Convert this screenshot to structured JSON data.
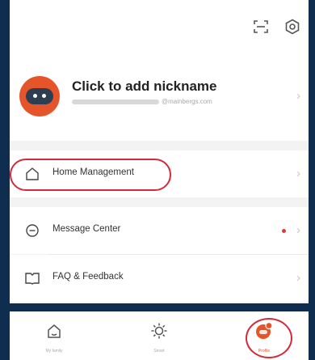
{
  "profile": {
    "nickname": "Click to add nickname",
    "account_suffix": "@mainbergs.com"
  },
  "menu": {
    "home_management": "Home Management",
    "message_center": "Message Center",
    "faq_feedback": "FAQ & Feedback",
    "message_unread": true
  },
  "tabs": [
    {
      "label": "My family",
      "icon": "home-icon"
    },
    {
      "label": "Smart",
      "icon": "sun-icon"
    },
    {
      "label": "Profile",
      "icon": "profile-icon",
      "active": true
    }
  ],
  "colors": {
    "accent": "#e6552a",
    "annotation": "#d22b3b",
    "frame": "#0f2d4f",
    "unread_dot": "#e03a2f"
  },
  "icons": {
    "top_left": "scan-icon",
    "top_right": "settings-icon",
    "avatar": "robot-avatar"
  }
}
